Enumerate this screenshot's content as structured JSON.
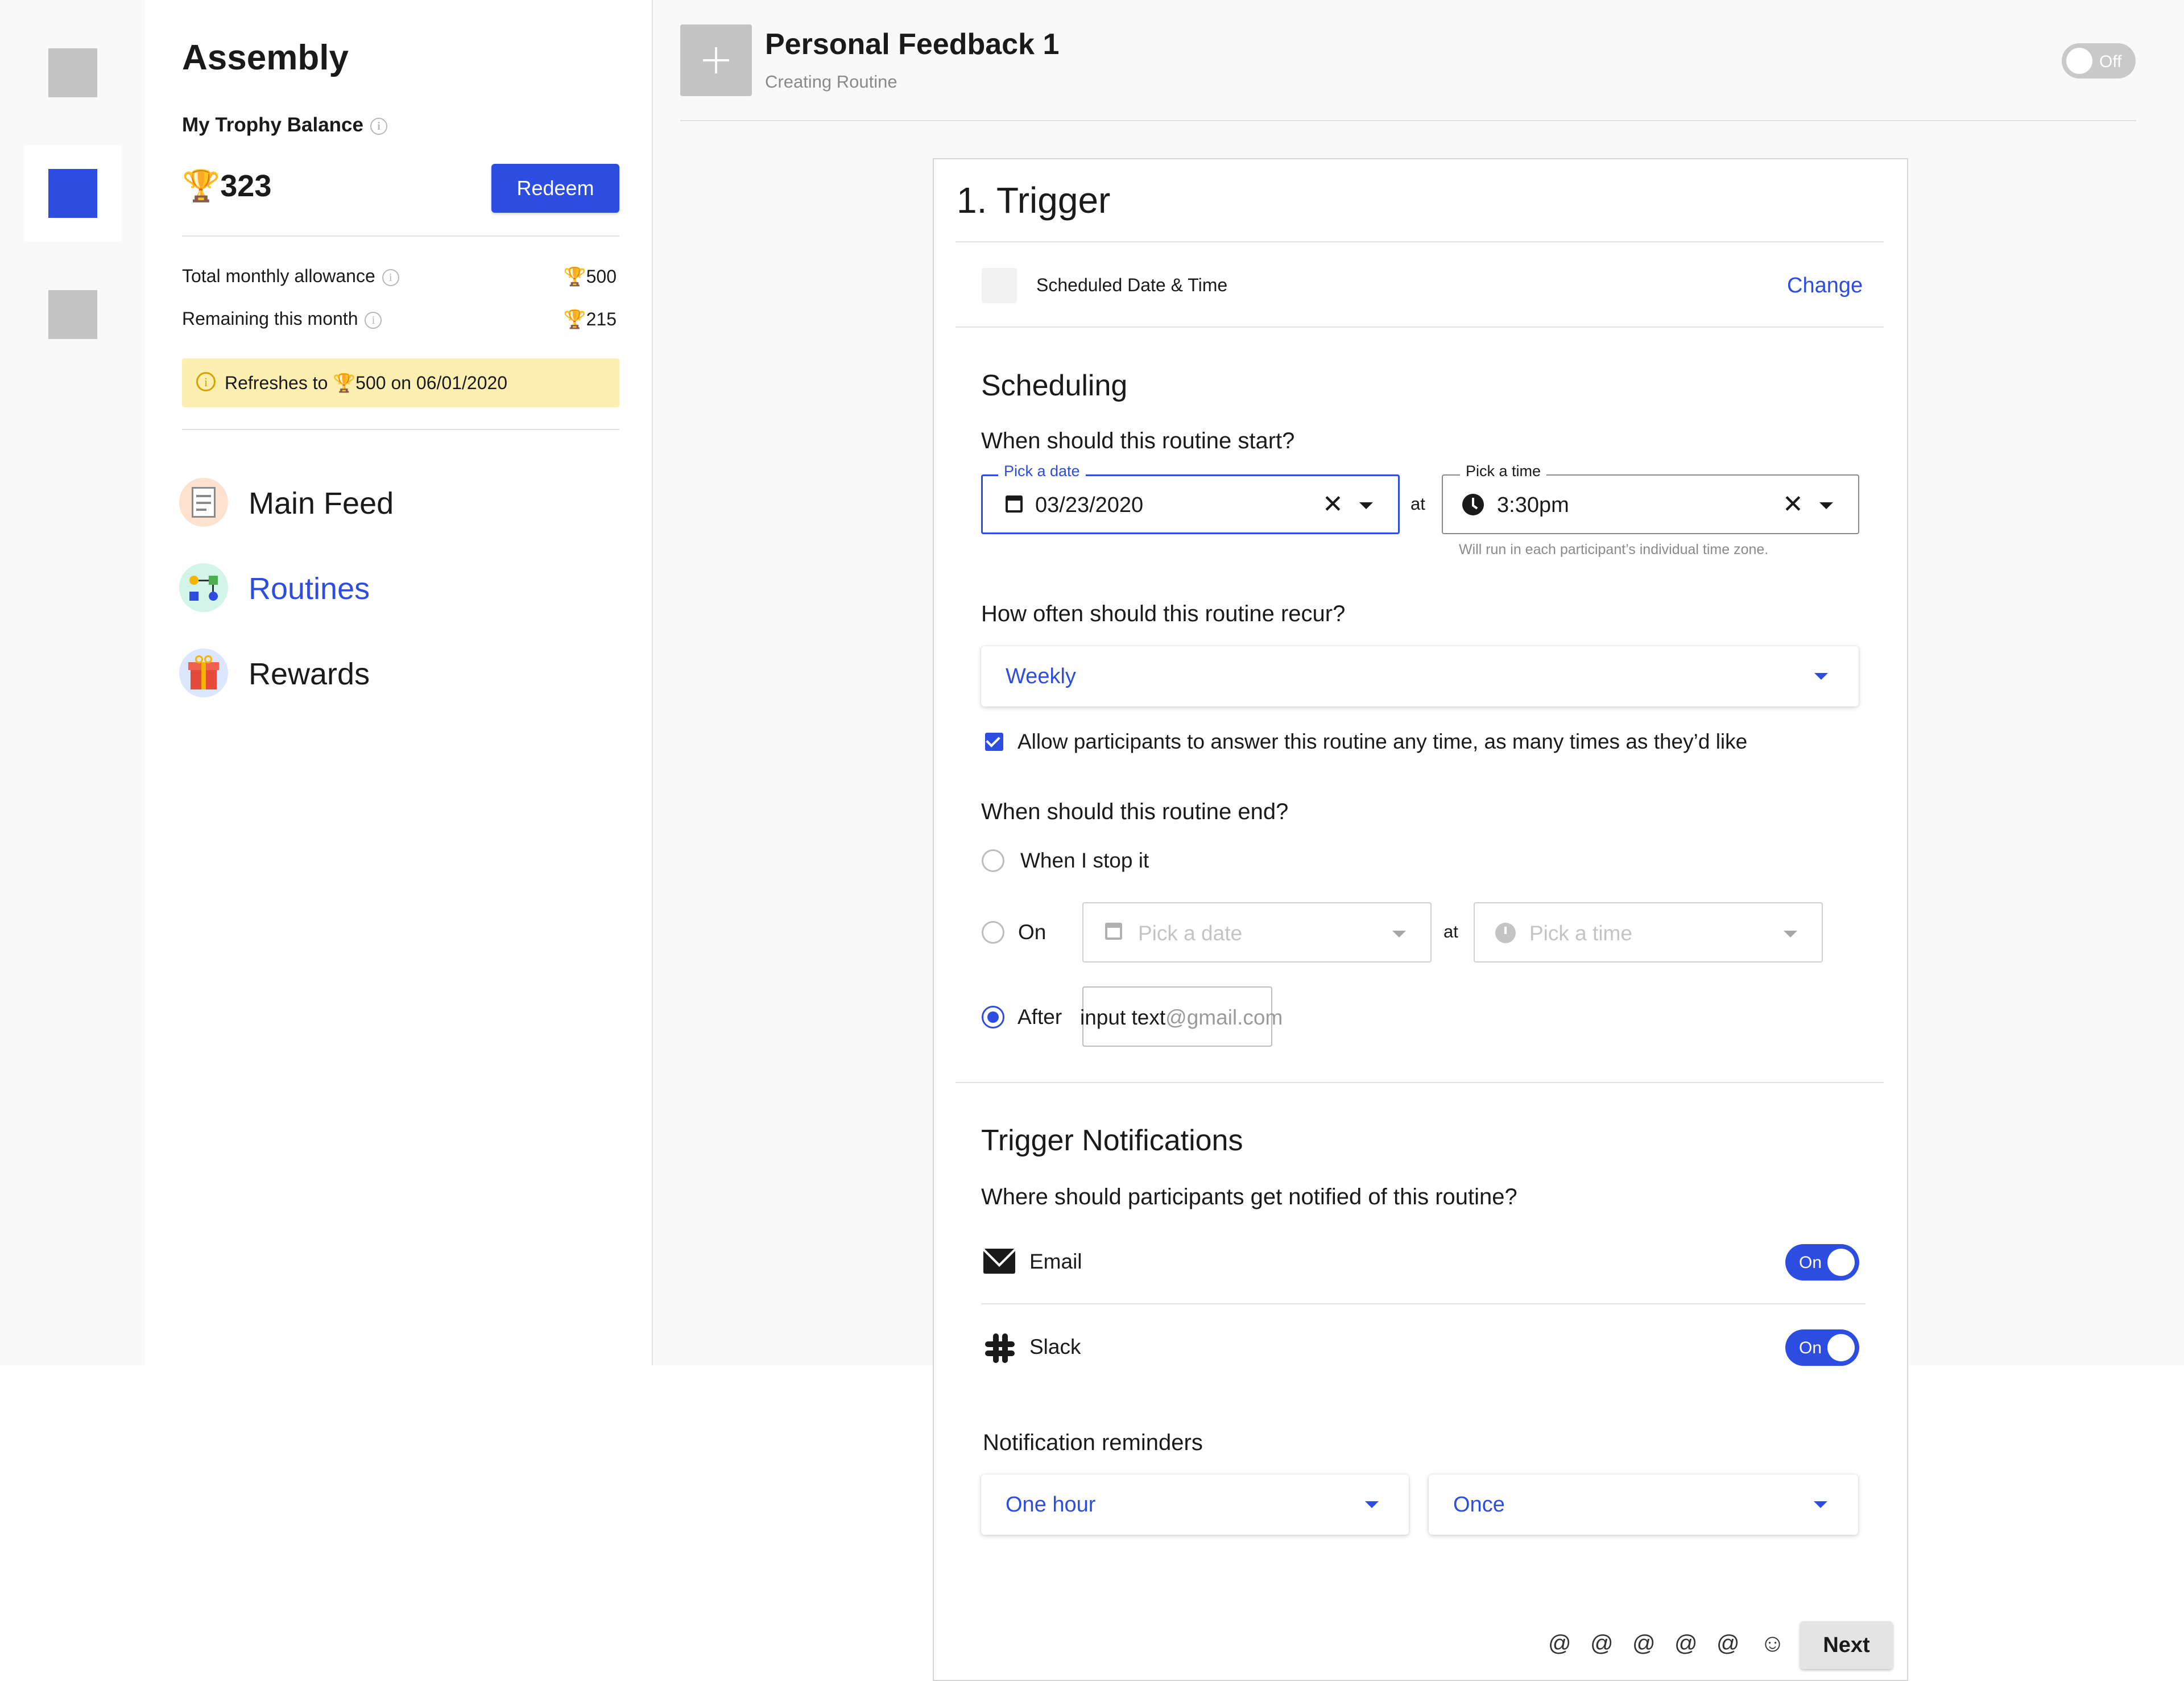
{
  "left_panel": {
    "brand": "Assembly",
    "balance_label": "My Trophy Balance",
    "balance_value": "323",
    "redeem_label": "Redeem",
    "allowance_label": "Total monthly allowance",
    "allowance_value": "500",
    "remaining_label": "Remaining this month",
    "remaining_value": "215",
    "refresh_text_pre": "Refreshes to ",
    "refresh_text_post": "500 on 06/01/2020",
    "nav": [
      {
        "label": "Main Feed",
        "active": false,
        "icon": "newspaper-icon"
      },
      {
        "label": "Routines",
        "active": true,
        "icon": "flowchart-icon"
      },
      {
        "label": "Rewards",
        "active": false,
        "icon": "gift-icon"
      }
    ]
  },
  "header": {
    "title": "Personal Feedback 1",
    "subtitle": "Creating Routine",
    "status_toggle": "Off"
  },
  "trigger": {
    "title": "1. Trigger",
    "type_label": "Scheduled Date & Time",
    "change_label": "Change"
  },
  "scheduling": {
    "heading": "Scheduling",
    "start_question": "When should this routine start?",
    "date_label": "Pick a date",
    "date_value": "03/23/2020",
    "at_label": "at",
    "time_label": "Pick a time",
    "time_value": "3:30pm",
    "timezone_hint": "Will run in each participant’s individual time zone.",
    "recur_question": "How often should this routine recur?",
    "recur_value": "Weekly",
    "allow_any_time_label": "Allow participants to answer this routine any time, as many times as they’d like",
    "allow_any_time_checked": true,
    "end_question": "When should this routine end?",
    "end_options": {
      "stop": "When I stop it",
      "on": "On",
      "after": "After"
    },
    "end_selected": "after",
    "end_date_placeholder": "Pick a date",
    "end_at_label": "at",
    "end_time_placeholder": "Pick a time",
    "after_input_text": "input text",
    "after_input_placeholder": "@gmail.com"
  },
  "notifications": {
    "heading": "Trigger Notifications",
    "question": "Where should participants get notified of this routine?",
    "channels": [
      {
        "label": "Email",
        "state": "On",
        "icon": "envelope-icon"
      },
      {
        "label": "Slack",
        "state": "On",
        "icon": "slack-icon"
      }
    ],
    "reminders_heading": "Notification reminders",
    "reminder_interval": "One hour",
    "reminder_frequency": "Once"
  },
  "footer": {
    "icons": [
      "@",
      "@",
      "@",
      "@",
      "@",
      "☺"
    ],
    "next_label": "Next"
  },
  "colors": {
    "accent": "#2d4de0",
    "refresh_banner": "#fdefb2",
    "placeholder_grey": "#c4c4c4"
  }
}
